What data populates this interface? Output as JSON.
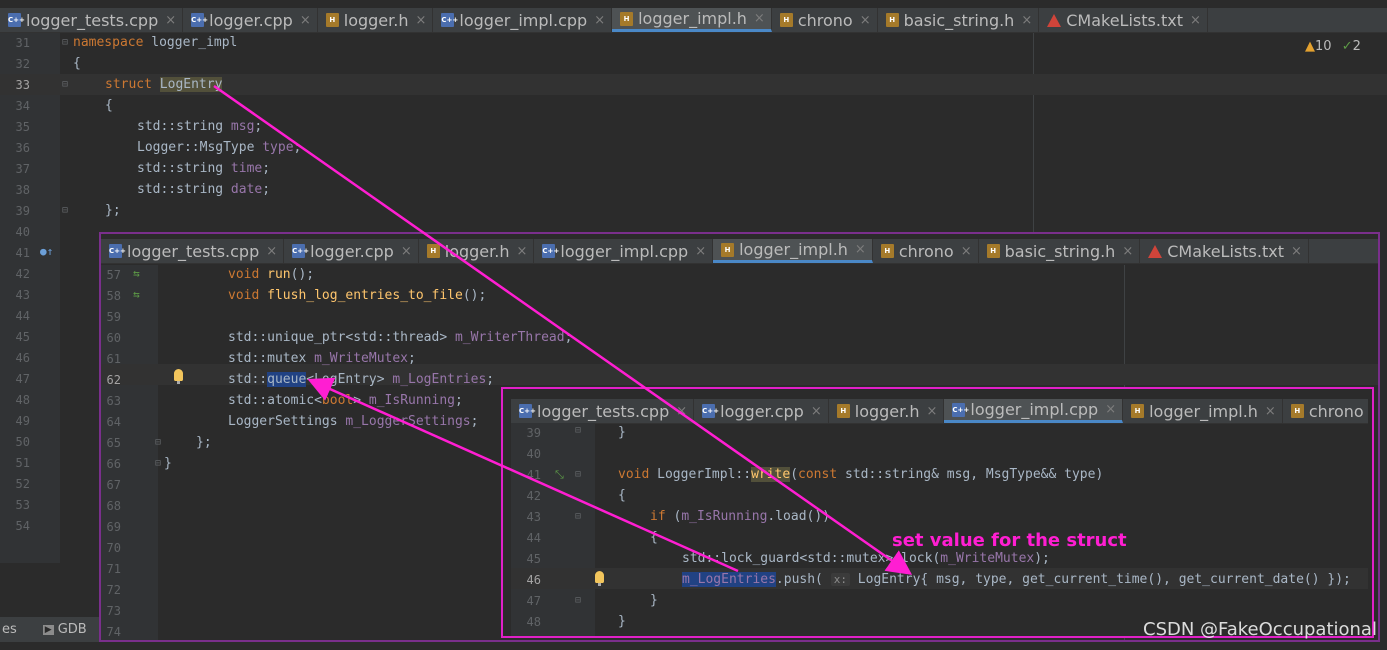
{
  "tabs_full": [
    {
      "label": "logger_tests.cpp",
      "kind": "cpp"
    },
    {
      "label": "logger.cpp",
      "kind": "cpp"
    },
    {
      "label": "logger.h",
      "kind": "h"
    },
    {
      "label": "logger_impl.cpp",
      "kind": "cpp"
    },
    {
      "label": "logger_impl.h",
      "kind": "h",
      "active": true
    },
    {
      "label": "chrono",
      "kind": "h"
    },
    {
      "label": "basic_string.h",
      "kind": "h"
    },
    {
      "label": "CMakeLists.txt",
      "kind": "cm"
    }
  ],
  "tabs_small": [
    {
      "label": "logger_tests.cpp",
      "kind": "cpp"
    },
    {
      "label": "logger.cpp",
      "kind": "cpp"
    },
    {
      "label": "logger.h",
      "kind": "h"
    },
    {
      "label": "logger_impl.cpp",
      "kind": "cpp",
      "active": true
    },
    {
      "label": "logger_impl.h",
      "kind": "h"
    },
    {
      "label": "chrono",
      "kind": "h"
    }
  ],
  "inspections": {
    "warnings": "10",
    "checks": "2"
  },
  "bottom_tool": {
    "left_tab": "es",
    "gdb_tab": "GDB"
  },
  "panel1": {
    "lines": [
      "31",
      "32",
      "33",
      "34",
      "35",
      "36",
      "37",
      "38",
      "39",
      "40",
      "41",
      "42",
      "43",
      "44",
      "45",
      "46",
      "47",
      "48",
      "49",
      "50",
      "51",
      "52",
      "53",
      "54"
    ],
    "current_line": "33",
    "code": {
      "ns_kw": "namespace",
      "ns_name": " logger_impl",
      "brace_open": "{",
      "struct_kw": "struct ",
      "struct_name": "LogEntry",
      "brace_open2": "{",
      "f1_type": "std::string ",
      "f1_name": "msg",
      "semi": ";",
      "f2_type": "Logger::MsgType ",
      "f2_name": "type",
      "f3_type": "std::string ",
      "f3_name": "time",
      "f4_type": "std::string ",
      "f4_name": "date",
      "brace_close": "};"
    }
  },
  "panel2": {
    "lines": [
      "57",
      "58",
      "59",
      "60",
      "61",
      "62",
      "63",
      "64",
      "65",
      "66",
      "67",
      "68",
      "69",
      "70",
      "71",
      "72",
      "73",
      "74"
    ],
    "current_line": "62",
    "code": {
      "void_kw": "void ",
      "run_fn": "run",
      "run_rest": "();",
      "flush_fn": "flush_log_entries_to_file",
      "up_type": "std::unique_ptr<std::thread> ",
      "up_name": "m_WriterThread",
      "mx_type": "std::mutex ",
      "mx_name": "m_WriteMutex",
      "q_ns": "std::",
      "q_kw": "queue",
      "q_rest": "<LogEntry> ",
      "q_name": "m_LogEntries",
      "at_type": "std::atomic<",
      "at_kw": "bool",
      "at_rest": "> ",
      "at_name": "m_IsRunning",
      "ls_type": "LoggerSettings ",
      "ls_name": "m_LoggerSettings",
      "close1": "};",
      "close2": "}"
    }
  },
  "panel3": {
    "lines": [
      "39",
      "40",
      "41",
      "42",
      "43",
      "44",
      "45",
      "46",
      "47",
      "48"
    ],
    "current_line": "46",
    "code": {
      "close_brace": "}",
      "void_kw": "void ",
      "cls": "LoggerImpl::",
      "write_fn": "write",
      "params_a": "(",
      "const_kw": "const ",
      "params_b": "std::string& msg, MsgType&& type)",
      "open_brace": "{",
      "if_kw": "if ",
      "if_rest": "(",
      "running": "m_IsRunning",
      ".load": ".load())",
      "lg_type": "std::lock_guard<std::mutex> ",
      "lg_var": "lock",
      "lg_p1": "(",
      "lg_mutex": "m_WriteMutex",
      "lg_p2": ");",
      "push_var": "m_LogEntries",
      "push_call": ".push( ",
      "hint": "x:",
      "push_args": "LogEntry{ msg, type, get_current_time(), get_current_date() });"
    }
  },
  "annotation": "set value for the struct",
  "watermark": "CSDN @FakeOccupational",
  "colors": {
    "annotation": "#ff1ed2",
    "panel_border": "#e020c8",
    "outer_border": "#7a2f8c"
  }
}
